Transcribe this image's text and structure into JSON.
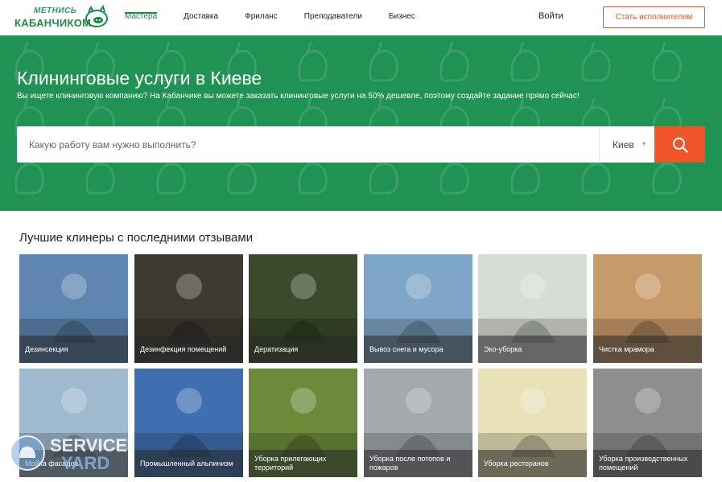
{
  "header": {
    "logo_line1": "МЕТНИСЬ",
    "logo_line2": "КАБАНЧИКОМ",
    "nav": [
      {
        "label": "Мастера",
        "active": true
      },
      {
        "label": "Доставка",
        "active": false
      },
      {
        "label": "Фриланс",
        "active": false
      },
      {
        "label": "Преподаватели",
        "active": false
      },
      {
        "label": "Бизнес",
        "active": false
      }
    ],
    "login_label": "Войти",
    "cta_label": "Стать исполнителем"
  },
  "hero": {
    "title": "Клининговые услуги в Киеве",
    "subtitle": "Вы ищете клининговую компанию? На Кабанчике вы можете заказать клининговые услуги на 50% дешевле, поэтому создайте задание прямо сейчас!",
    "search_placeholder": "Какую работу вам нужно выполнить?",
    "city": "Киев",
    "search_icon": "search-icon"
  },
  "section": {
    "title": "Лучшие клинеры с последними отзывами",
    "tiles": [
      {
        "label": "Дезинсекция",
        "bg": "#5f86b0"
      },
      {
        "label": "Дезинфекция помещений",
        "bg": "#3e3a32"
      },
      {
        "label": "Дератизация",
        "bg": "#3a4a2a"
      },
      {
        "label": "Вывоз снега и мусора",
        "bg": "#7fa6c6"
      },
      {
        "label": "Эко-уборка",
        "bg": "#d7dcd4"
      },
      {
        "label": "Чистка мрамора",
        "bg": "#c79a6a"
      },
      {
        "label": "Мойка фасадов",
        "bg": "#9fb9cf"
      },
      {
        "label": "Промышленный альпинизм",
        "bg": "#3f6fb0"
      },
      {
        "label": "Уборка прилегающих территорий",
        "bg": "#6c8a3a"
      },
      {
        "label": "Уборка после потопов и пожаров",
        "bg": "#a3a9ad"
      },
      {
        "label": "Уборка ресторанов",
        "bg": "#e9e1b8"
      },
      {
        "label": "Уборка производственных помещений",
        "bg": "#8d8e8e"
      }
    ]
  },
  "watermark": {
    "line1": "SERVICE",
    "line2": "YARD"
  }
}
